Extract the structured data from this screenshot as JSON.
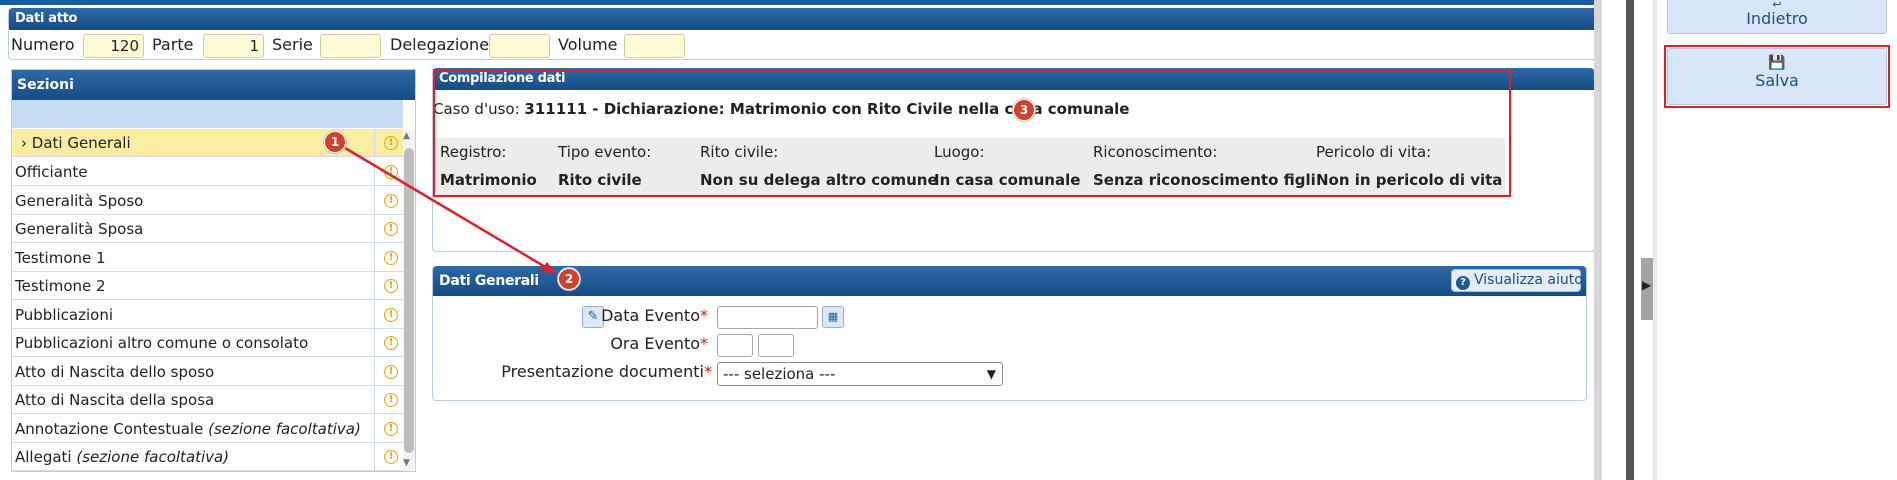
{
  "dati_atto": {
    "title": "Dati atto",
    "fields": [
      {
        "label": "Numero",
        "value": "120"
      },
      {
        "label": "Parte",
        "value": "1"
      },
      {
        "label": "Serie",
        "value": ""
      },
      {
        "label": "Delegazione",
        "value": ""
      },
      {
        "label": "Volume",
        "value": ""
      }
    ]
  },
  "sezioni": {
    "title": "Sezioni",
    "items": [
      {
        "label": "Dati Generali",
        "prefix": "›",
        "selected": true
      },
      {
        "label": "Officiante"
      },
      {
        "label": "Generalità Sposo"
      },
      {
        "label": "Generalità Sposa"
      },
      {
        "label": "Testimone 1"
      },
      {
        "label": "Testimone 2"
      },
      {
        "label": "Pubblicazioni"
      },
      {
        "label": "Pubblicazioni altro comune o consolato"
      },
      {
        "label": "Atto di Nascita dello sposo"
      },
      {
        "label": "Atto di Nascita della sposa"
      },
      {
        "label": "Annotazione Contestuale",
        "note": "(sezione facoltativa)"
      },
      {
        "label": "Allegati",
        "note": "(sezione facoltativa)"
      }
    ],
    "warn_icon": "warning-icon"
  },
  "compilazione": {
    "title": "Compilazione dati",
    "caso_label": "Caso d'uso:",
    "caso_value": "311111 - Dichiarazione: Matrimonio con Rito Civile nella casa comunale",
    "columns": [
      {
        "header": "Registro:",
        "value": "Matrimonio"
      },
      {
        "header": "Tipo evento:",
        "value": "Rito civile"
      },
      {
        "header": "Rito civile:",
        "value": "Non su delega altro comune"
      },
      {
        "header": "Luogo:",
        "value": "In casa comunale"
      },
      {
        "header": "Riconoscimento:",
        "value": "Senza riconoscimento figli"
      },
      {
        "header": "Pericolo di vita:",
        "value": "Non in pericolo di vita"
      }
    ]
  },
  "dati_generali": {
    "title": "Dati Generali",
    "help_label": "Visualizza aiuto",
    "data_evento_label": "Data Evento",
    "ora_evento_label": "Ora Evento",
    "presentazione_label": "Presentazione documenti",
    "presentazione_value": "--- seleziona ---",
    "required_mark": "*"
  },
  "actions": {
    "indietro_label": "Indietro",
    "salva_label": "Salva"
  },
  "annotations": {
    "badge_1": "1",
    "badge_2": "2",
    "badge_3": "3",
    "highlight_color": "#e02029"
  }
}
